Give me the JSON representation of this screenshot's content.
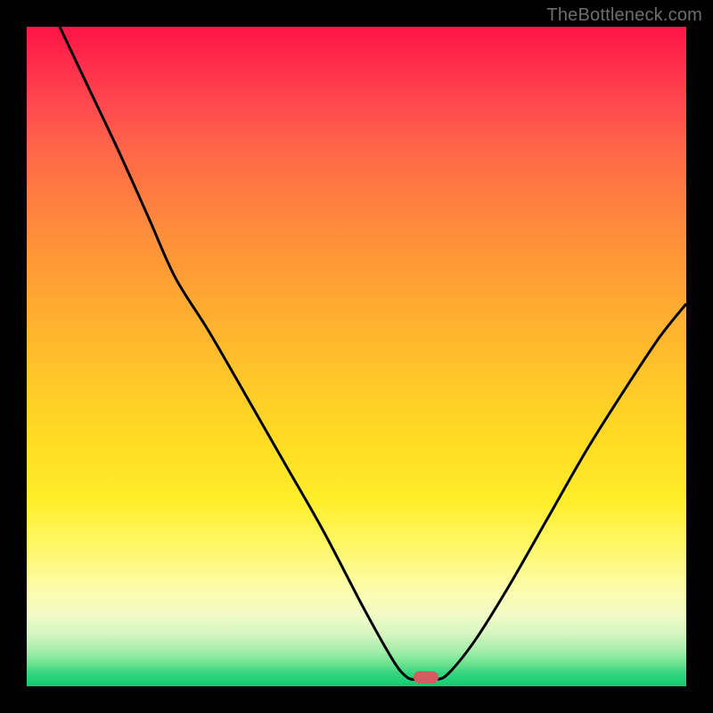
{
  "attribution": "TheBottleneck.com",
  "marker": {
    "x_fraction": 0.605,
    "y_fraction": 0.987
  },
  "chart_data": {
    "type": "line",
    "title": "",
    "xlabel": "",
    "ylabel": "",
    "xlim": [
      0,
      1
    ],
    "ylim": [
      0,
      1
    ],
    "annotations": [
      {
        "text": "TheBottleneck.com",
        "position": "top-right"
      }
    ],
    "background_gradient": {
      "direction": "vertical",
      "stops": [
        {
          "t": 0.0,
          "color": "#ff1547"
        },
        {
          "t": 0.25,
          "color": "#ff7a41"
        },
        {
          "t": 0.56,
          "color": "#ffcd27"
        },
        {
          "t": 0.85,
          "color": "#fcfcaa"
        },
        {
          "t": 1.0,
          "color": "#0fcd70"
        }
      ]
    },
    "series": [
      {
        "name": "bottleneck-curve",
        "color": "#000000",
        "stroke_width": 3,
        "points": [
          {
            "x": 0.05,
            "y": 1.0
          },
          {
            "x": 0.095,
            "y": 0.905
          },
          {
            "x": 0.14,
            "y": 0.81
          },
          {
            "x": 0.185,
            "y": 0.71
          },
          {
            "x": 0.225,
            "y": 0.62
          },
          {
            "x": 0.275,
            "y": 0.54
          },
          {
            "x": 0.33,
            "y": 0.445
          },
          {
            "x": 0.39,
            "y": 0.34
          },
          {
            "x": 0.45,
            "y": 0.235
          },
          {
            "x": 0.51,
            "y": 0.12
          },
          {
            "x": 0.555,
            "y": 0.04
          },
          {
            "x": 0.575,
            "y": 0.015
          },
          {
            "x": 0.59,
            "y": 0.01
          },
          {
            "x": 0.62,
            "y": 0.01
          },
          {
            "x": 0.64,
            "y": 0.02
          },
          {
            "x": 0.68,
            "y": 0.07
          },
          {
            "x": 0.73,
            "y": 0.15
          },
          {
            "x": 0.79,
            "y": 0.255
          },
          {
            "x": 0.85,
            "y": 0.36
          },
          {
            "x": 0.91,
            "y": 0.455
          },
          {
            "x": 0.96,
            "y": 0.53
          },
          {
            "x": 1.0,
            "y": 0.58
          }
        ]
      }
    ],
    "marker": {
      "x": 0.605,
      "y": 0.013,
      "color": "#cf5d61",
      "shape": "pill"
    }
  }
}
